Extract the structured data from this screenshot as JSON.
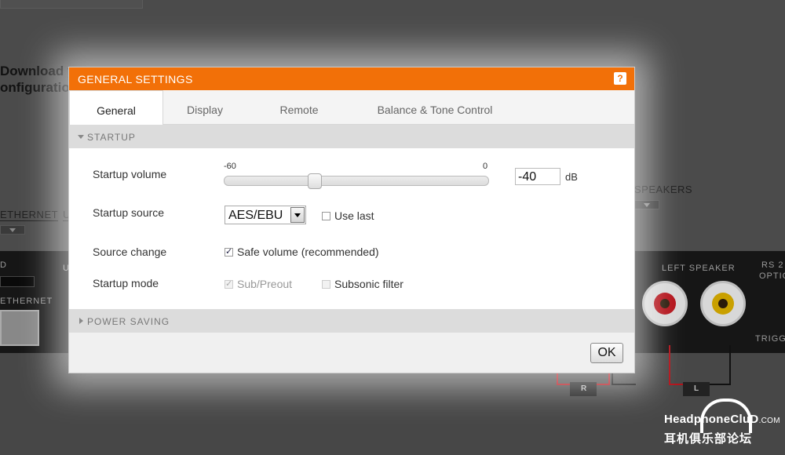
{
  "background": {
    "download_text": "Download yo\nonfiguration",
    "ethernet_top": "ETHERNET",
    "u_label": "U",
    "speakers": "SPEAKERS",
    "d_label": "D",
    "u2_label": "U",
    "ethernet_bottom": "ETHERNET",
    "left_speaker": "LEFT SPEAKER",
    "rs_label": "RS 2",
    "optic_label": "OPTIC",
    "trigg_label": "TRIGG",
    "spk_r": "R",
    "spk_l": "L"
  },
  "watermark": {
    "top": "HeadphoneCluD",
    "top_suffix": ".COM",
    "bottom": "耳机俱乐部论坛"
  },
  "dialog": {
    "title": "GENERAL SETTINGS",
    "help": "?",
    "tabs": [
      {
        "label": "General",
        "active": true
      },
      {
        "label": "Display",
        "active": false
      },
      {
        "label": "Remote",
        "active": false
      },
      {
        "label": "Balance & Tone Control",
        "active": false
      }
    ],
    "startup": {
      "header": "STARTUP",
      "volume_label": "Startup volume",
      "slider_min": "-60",
      "slider_max": "0",
      "volume_value": "-40",
      "volume_unit": "dB",
      "slider_position": 0.333,
      "source_label": "Startup source",
      "source_value": "AES/EBU",
      "use_last_label": "Use last",
      "use_last_checked": false,
      "source_change_label": "Source change",
      "safe_volume_label": "Safe volume (recommended)",
      "safe_volume_checked": true,
      "mode_label": "Startup mode",
      "sub_preout_label": "Sub/Preout",
      "sub_preout_checked": true,
      "subsonic_label": "Subsonic filter",
      "subsonic_checked": false
    },
    "power_saving": {
      "header": "POWER SAVING"
    },
    "ok_label": "OK"
  },
  "colors": {
    "accent": "#f27008",
    "jack_ring_red": "#b3121a",
    "jack_ring_gold": "#c9a000"
  }
}
